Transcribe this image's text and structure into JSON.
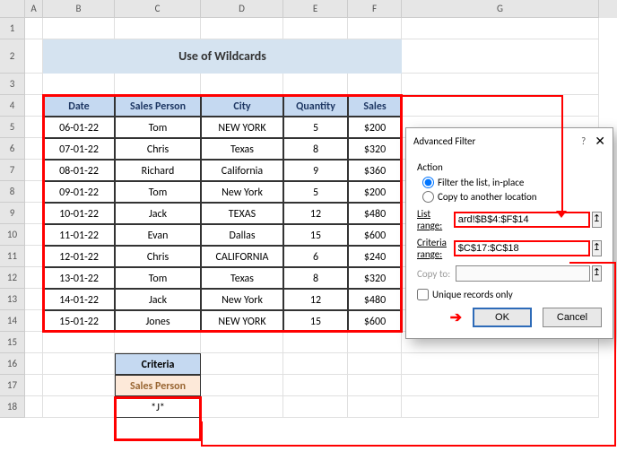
{
  "columns": [
    "A",
    "B",
    "C",
    "D",
    "E",
    "F",
    "G"
  ],
  "rows": [
    "1",
    "2",
    "3",
    "4",
    "5",
    "6",
    "7",
    "8",
    "9",
    "10",
    "11",
    "12",
    "13",
    "14",
    "15",
    "16",
    "17",
    "18"
  ],
  "title": "Use of Wildcards",
  "headers": [
    "Date",
    "Sales Person",
    "City",
    "Quantity",
    "Sales"
  ],
  "data": [
    [
      "06-01-22",
      "Tom",
      "NEW YORK",
      "5",
      "$200"
    ],
    [
      "07-01-22",
      "Chris",
      "Texas",
      "8",
      "$320"
    ],
    [
      "08-01-22",
      "Richard",
      "California",
      "9",
      "$360"
    ],
    [
      "09-01-22",
      "Tom",
      "New York",
      "5",
      "$200"
    ],
    [
      "10-01-22",
      "Jack",
      "TEXAS",
      "12",
      "$480"
    ],
    [
      "11-01-22",
      "Evan",
      "Dallas",
      "15",
      "$600"
    ],
    [
      "12-01-22",
      "Chris",
      "CALIFORNIA",
      "6",
      "$240"
    ],
    [
      "13-01-22",
      "Tom",
      "Texas",
      "8",
      "$320"
    ],
    [
      "14-01-22",
      "Jack",
      "New York",
      "12",
      "$480"
    ],
    [
      "15-01-22",
      "Jones",
      "NEW YORK",
      "15",
      "$600"
    ]
  ],
  "criteria": {
    "label": "Criteria",
    "header": "Sales Person",
    "value": "*J*"
  },
  "dialog": {
    "title": "Advanced Filter",
    "help": "?",
    "close": "✕",
    "action_label": "Action",
    "opt_inplace": "Filter the list, in-place",
    "opt_copy": "Copy to another location",
    "list_range_label": "List range:",
    "list_range_value": "ard!$B$4:$F$14",
    "criteria_range_label": "Criteria range:",
    "criteria_range_value": "$C$17:$C$18",
    "copy_to_label": "Copy to:",
    "copy_to_value": "",
    "unique_label": "Unique records only",
    "ok": "OK",
    "cancel": "Cancel",
    "picker": "↥"
  }
}
